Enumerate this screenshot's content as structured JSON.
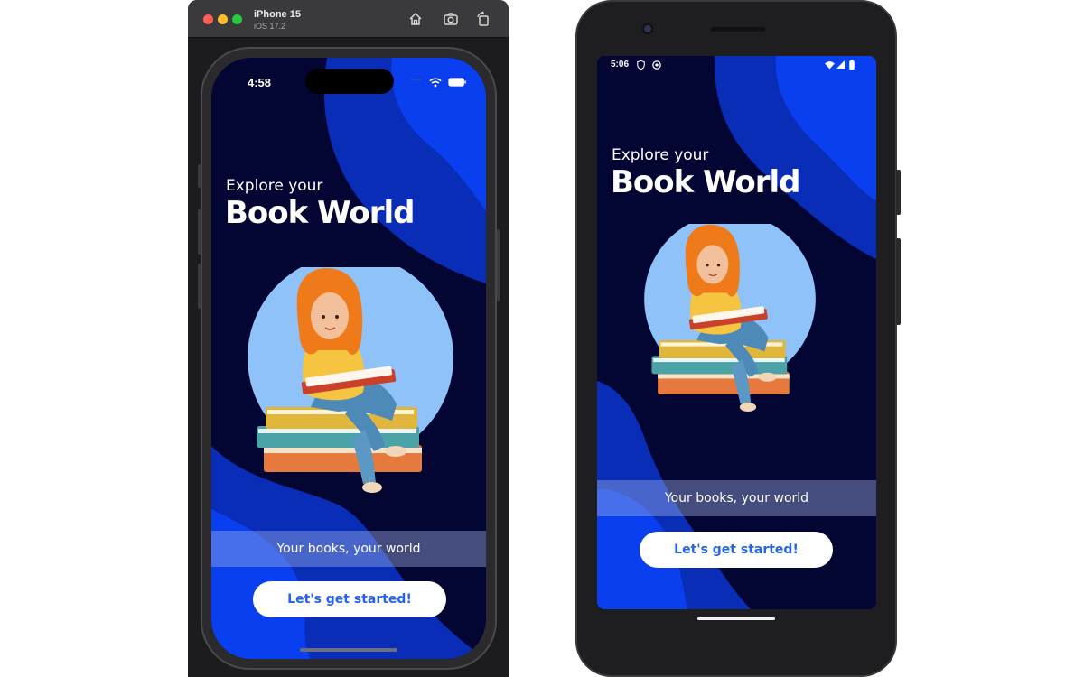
{
  "ios": {
    "simulator": {
      "device_name": "iPhone 15",
      "os_version": "iOS 17.2"
    },
    "status_bar": {
      "time": "4:58"
    }
  },
  "android": {
    "status_bar": {
      "time": "5:06"
    }
  },
  "app": {
    "headline_small": "Explore your",
    "headline_large": "Book World",
    "tagline": "Your books, your world",
    "cta_label": "Let's get started!",
    "accent_color": "#2563eb",
    "background_color": "#030532",
    "wave_color": "#0a3ff0",
    "circle_color": "#8ec2f8"
  },
  "icons": {
    "toolbar": [
      "home-icon",
      "screenshot-icon",
      "rotate-icon"
    ],
    "ios_status": [
      "wifi-icon",
      "battery-icon"
    ],
    "android_status": [
      "shield-icon",
      "notification-icon",
      "wifi-icon",
      "signal-icon",
      "battery-icon"
    ]
  }
}
